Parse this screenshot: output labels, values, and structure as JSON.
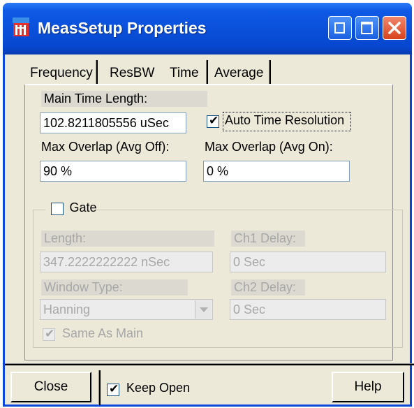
{
  "window": {
    "title": "MeasSetup Properties"
  },
  "tabs": [
    {
      "label": "Frequency",
      "active": false
    },
    {
      "label": "ResBW",
      "active": false
    },
    {
      "label": "Time",
      "active": true
    },
    {
      "label": "Average",
      "active": false
    }
  ],
  "time": {
    "main_time_length_label": "Main Time Length:",
    "main_time_length_value": "102.8211805556 uSec",
    "auto_time_resolution_label": "Auto Time Resolution",
    "auto_time_resolution_checked": true,
    "max_overlap_avg_off_label": "Max Overlap (Avg Off):",
    "max_overlap_avg_off_value": "90 %",
    "max_overlap_avg_on_label": "Max Overlap (Avg On):",
    "max_overlap_avg_on_value": "0 %"
  },
  "gate": {
    "label": "Gate",
    "checked": false,
    "length_label": "Length:",
    "length_value": "347.2222222222 nSec",
    "ch1_delay_label": "Ch1 Delay:",
    "ch1_delay_value": "0 Sec",
    "window_type_label": "Window Type:",
    "window_type_value": "Hanning",
    "ch2_delay_label": "Ch2 Delay:",
    "ch2_delay_value": "0 Sec",
    "same_as_main_label": "Same As Main",
    "same_as_main_checked": true
  },
  "footer": {
    "close_label": "Close",
    "keep_open_label": "Keep Open",
    "keep_open_checked": true,
    "help_label": "Help"
  },
  "colors": {
    "titlebar": "#0a4fd8",
    "window_bg": "#ece9d8",
    "close_button": "#d8431e",
    "disabled_text": "#a7a7a7"
  },
  "icons": {
    "app": "app-icon",
    "minimize": "minimize-icon",
    "maximize": "maximize-icon",
    "close": "close-icon"
  }
}
